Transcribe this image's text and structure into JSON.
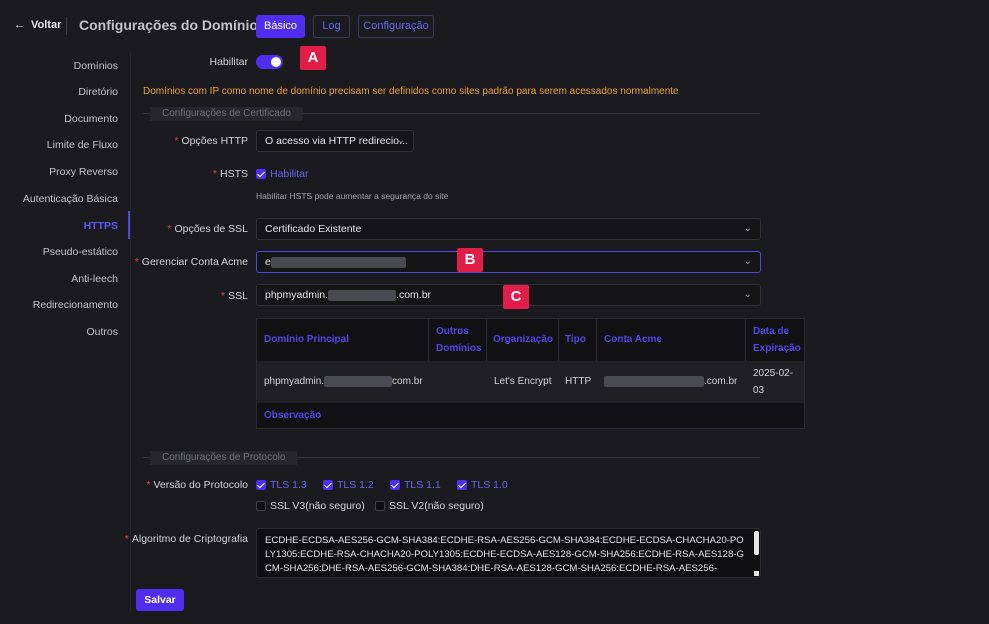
{
  "header": {
    "back_label": "Voltar",
    "title": "Configurações do Domínio",
    "tabs": [
      {
        "label": "Básico",
        "active": true
      },
      {
        "label": "Log",
        "active": false
      },
      {
        "label": "Configuração",
        "active": false
      }
    ]
  },
  "sidebar": {
    "active": "HTTPS",
    "items": [
      {
        "label": "Domínios"
      },
      {
        "label": "Diretório"
      },
      {
        "label": "Documento"
      },
      {
        "label": "Limite de Fluxo"
      },
      {
        "label": "Proxy Reverso"
      },
      {
        "label": "Autenticação Básica"
      },
      {
        "label": "HTTPS"
      },
      {
        "label": "Pseudo-estático"
      },
      {
        "label": "Anti-leech"
      },
      {
        "label": "Redirecionamento"
      },
      {
        "label": "Outros"
      }
    ]
  },
  "form": {
    "enable": {
      "label": "Habilitar",
      "value": true
    },
    "warning": "Domínios com IP como nome de domínio precisam ser definidos como sites padrão para serem acessados normalmente",
    "cert_section_title": "Configurações de Certificado",
    "http_options": {
      "label": "Opções HTTP",
      "value": "O acesso via HTTP redirecio..."
    },
    "hsts": {
      "label": "HSTS",
      "checkbox_label": "Habilitar",
      "checked": true,
      "help": "Habilitar HSTS pode aumentar a segurança do site"
    },
    "ssl_options": {
      "label": "Opções de SSL",
      "value": "Certificado Existente"
    },
    "acme_account": {
      "label": "Gerenciar Conta Acme",
      "value_prefix": "e"
    },
    "ssl": {
      "label": "SSL",
      "value_prefix": "phpmyadmin.",
      "value_suffix": ".com.br"
    },
    "protocol_section_title": "Configurações de Protocolo",
    "protocol_version": {
      "label": "Versão do Protocolo",
      "options": [
        {
          "label": "TLS 1.3",
          "checked": true
        },
        {
          "label": "TLS 1.2",
          "checked": true
        },
        {
          "label": "TLS 1.1",
          "checked": true
        },
        {
          "label": "TLS 1.0",
          "checked": true
        },
        {
          "label": "SSL V3(não seguro)",
          "checked": false
        },
        {
          "label": "SSL V2(não seguro)",
          "checked": false
        }
      ]
    },
    "cipher": {
      "label": "Algoritmo de Criptografia",
      "value": "ECDHE-ECDSA-AES256-GCM-SHA384:ECDHE-RSA-AES256-GCM-SHA384:ECDHE-ECDSA-CHACHA20-POLY1305:ECDHE-RSA-CHACHA20-POLY1305:ECDHE-ECDSA-AES128-GCM-SHA256:ECDHE-RSA-AES128-GCM-SHA256:DHE-RSA-AES256-GCM-SHA384:DHE-RSA-AES128-GCM-SHA256:ECDHE-RSA-AES256-"
    },
    "save_label": "Salvar"
  },
  "cert_table": {
    "headers": {
      "main_domain": "Domínio Principal",
      "other_domains_1": "Outros",
      "other_domains_2": "Domínios",
      "organization": "Organização",
      "type": "Tipo",
      "acme_account": "Conta Acme",
      "expiry_1": "Data de",
      "expiry_2": "Expiração"
    },
    "row": {
      "main_domain_prefix": "phpmyadmin.",
      "main_domain_suffix": "com.br",
      "other_domains": "",
      "organization": "Let's Encrypt",
      "type": "HTTP",
      "acme_account_suffix": ".com.br",
      "expiry_1": "2025-02-",
      "expiry_2": "03"
    },
    "note_label": "Observação"
  },
  "markers": {
    "a": "A",
    "b": "B",
    "c": "C"
  },
  "colors": {
    "accent": "#4f2ef2",
    "warning": "#e8a23a",
    "required": "#ef4444",
    "marker": "#e11d48"
  }
}
